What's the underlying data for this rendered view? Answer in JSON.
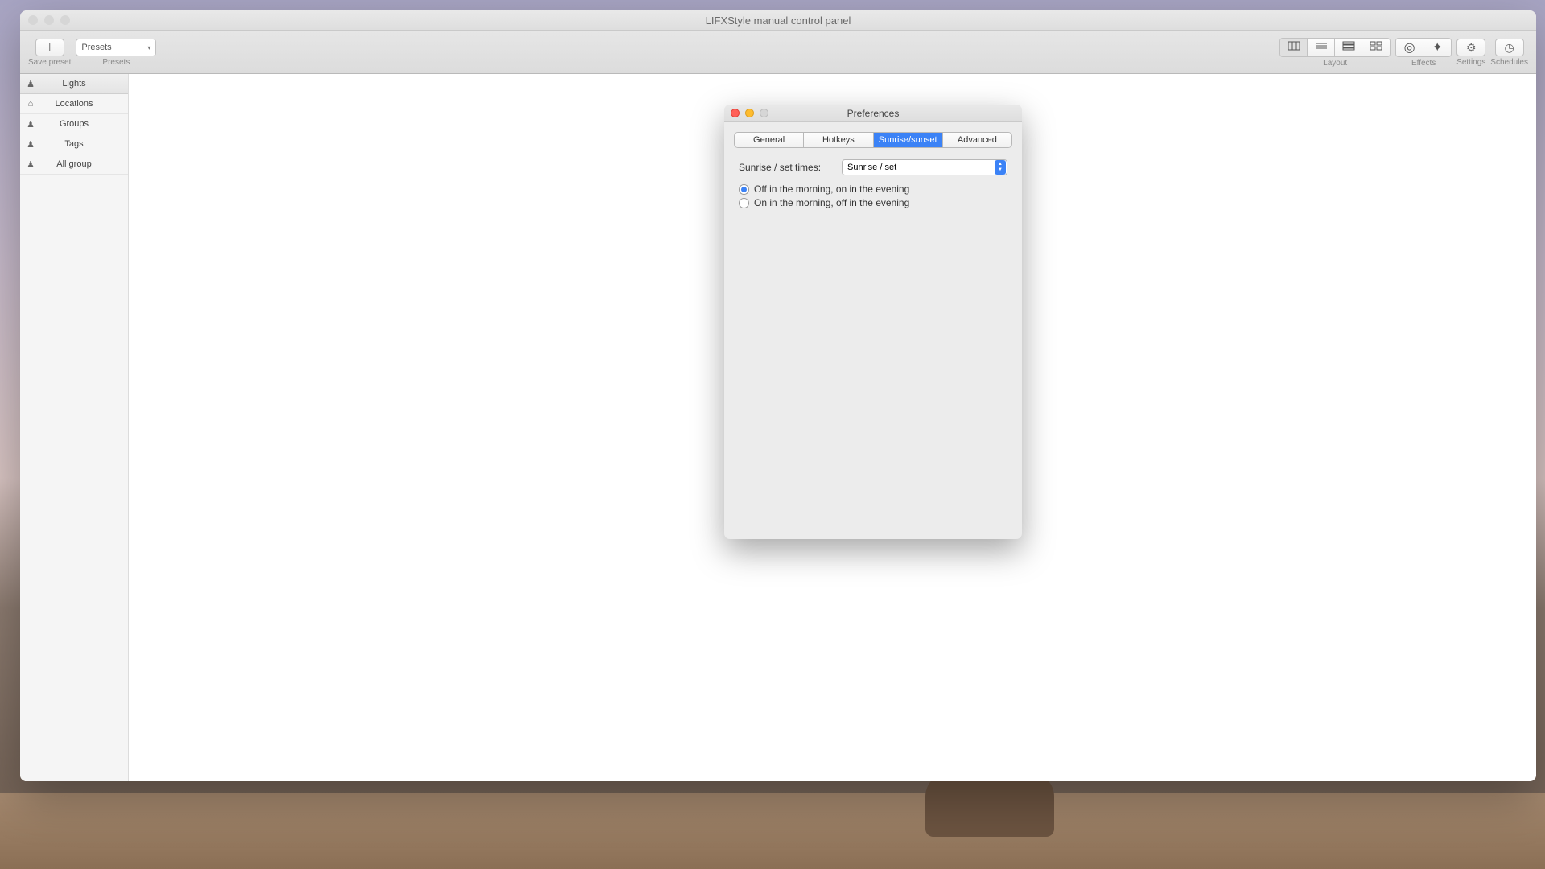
{
  "window": {
    "title": "LIFXStyle manual control panel"
  },
  "toolbar": {
    "save_preset_label": "Save preset",
    "presets_label": "Presets",
    "presets_select_value": "Presets",
    "layout_label": "Layout",
    "effects_label": "Effects",
    "settings_label": "Settings",
    "schedules_label": "Schedules"
  },
  "sidebar": {
    "items": [
      {
        "icon": "bulb",
        "label": "Lights"
      },
      {
        "icon": "home",
        "label": "Locations"
      },
      {
        "icon": "bulb",
        "label": "Groups"
      },
      {
        "icon": "bulb",
        "label": "Tags"
      },
      {
        "icon": "bulb",
        "label": "All group"
      }
    ]
  },
  "modal": {
    "title": "Preferences",
    "tabs": [
      {
        "label": "General",
        "active": false
      },
      {
        "label": "Hotkeys",
        "active": false
      },
      {
        "label": "Sunrise/sunset",
        "active": true
      },
      {
        "label": "Advanced",
        "active": false
      }
    ],
    "sunrise_set": {
      "label": "Sunrise / set times:",
      "select_value": "Sunrise / set",
      "radio_options": [
        {
          "label": "Off in the morning, on in the evening",
          "checked": true
        },
        {
          "label": "On in the morning, off in the evening",
          "checked": false
        }
      ]
    }
  },
  "colors": {
    "accent": "#3b82f6"
  }
}
